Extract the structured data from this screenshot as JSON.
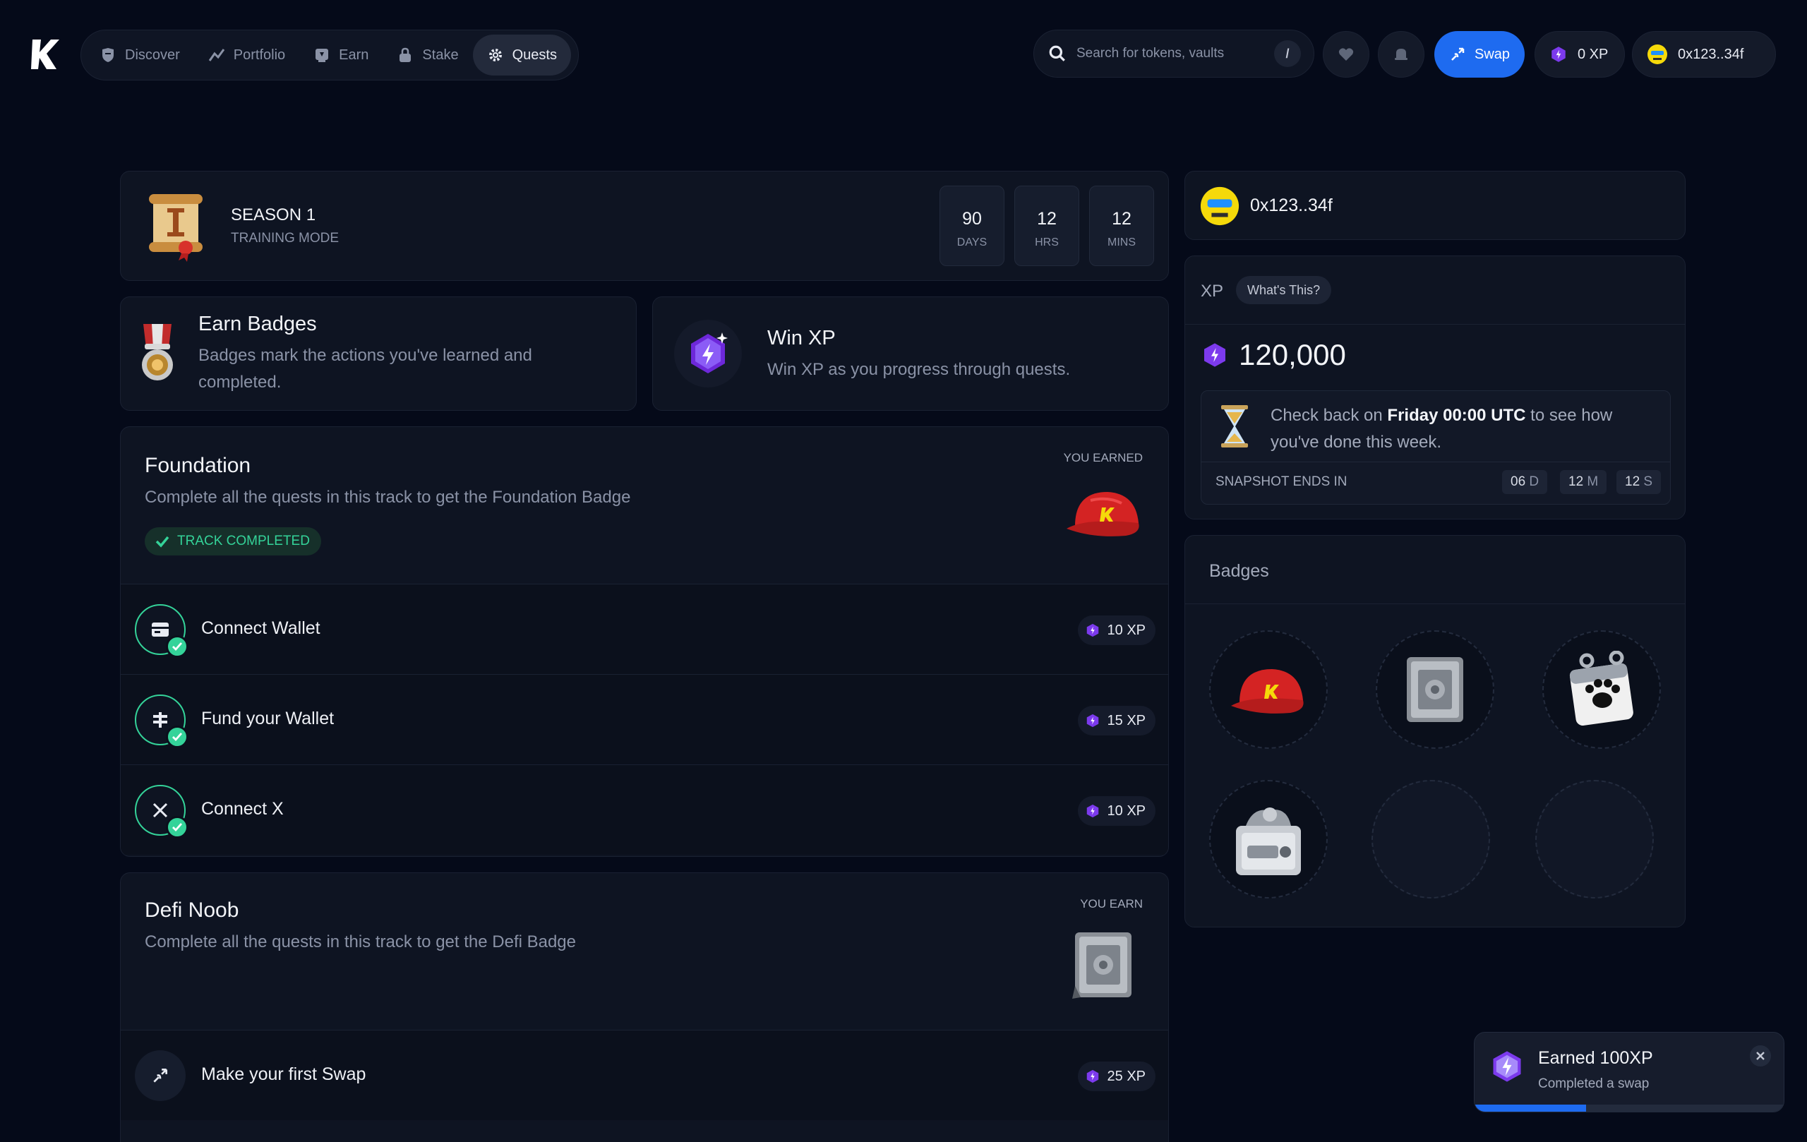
{
  "nav": {
    "items": [
      {
        "label": "Discover",
        "icon": "shield-icon",
        "active": false
      },
      {
        "label": "Portfolio",
        "icon": "chart-line-icon",
        "active": false
      },
      {
        "label": "Earn",
        "icon": "earn-icon",
        "active": false
      },
      {
        "label": "Stake",
        "icon": "lock-icon",
        "active": false
      },
      {
        "label": "Quests",
        "icon": "gear-icon",
        "active": true
      }
    ]
  },
  "search": {
    "placeholder": "Search for tokens, vaults",
    "shortcut": "/"
  },
  "header": {
    "swap_label": "Swap",
    "xp_label": "0 XP",
    "wallet_label": "0x123..34f"
  },
  "season": {
    "title": "SEASON 1",
    "subtitle": "TRAINING MODE",
    "countdown": [
      {
        "value": "90",
        "unit": "DAYS"
      },
      {
        "value": "12",
        "unit": "HRS"
      },
      {
        "value": "12",
        "unit": "MINS"
      }
    ]
  },
  "info_cards": {
    "badges": {
      "title": "Earn Badges",
      "line1": "Badges mark the actions you've learned and",
      "line2": "completed."
    },
    "xp": {
      "title": "Win XP",
      "desc": "Win XP as you progress through quests."
    }
  },
  "tracks": {
    "foundation": {
      "name": "Foundation",
      "desc": "Complete all the quests in this track to get the Foundation Badge",
      "earn_label": "YOU EARNED",
      "status": "TRACK COMPLETED",
      "quests": [
        {
          "label": "Connect Wallet",
          "xp": "10 XP"
        },
        {
          "label": "Fund your Wallet",
          "xp": "15 XP"
        },
        {
          "label": "Connect X",
          "xp": "10 XP"
        }
      ]
    },
    "defi": {
      "name": "Defi Noob",
      "desc": "Complete all the quests in this track to get the Defi Badge",
      "earn_label": "YOU EARN",
      "quests": [
        {
          "label": "Make your first Swap",
          "xp": "25 XP"
        }
      ]
    }
  },
  "profile": {
    "address": "0x123..34f",
    "xp_title": "XP",
    "whats_this": "What's This?",
    "xp_total": "120,000",
    "checkback_pre": "Check back on ",
    "checkback_bold": "Friday 00:00 UTC",
    "checkback_post": " to see how",
    "checkback_line2": "you've done this week.",
    "snapshot_label": "SNAPSHOT ENDS IN",
    "snapshot": [
      {
        "value": "06",
        "unit": "D"
      },
      {
        "value": "12",
        "unit": "M"
      },
      {
        "value": "12",
        "unit": "S"
      }
    ]
  },
  "badges_panel": {
    "title": "Badges"
  },
  "toast": {
    "title": "Earned 100XP",
    "sub": "Completed a swap",
    "progress": 0.36
  },
  "colors": {
    "accent": "#1e6bf0",
    "success": "#34d399",
    "xp_purple": "#7c3aed",
    "background": "#050a19"
  }
}
